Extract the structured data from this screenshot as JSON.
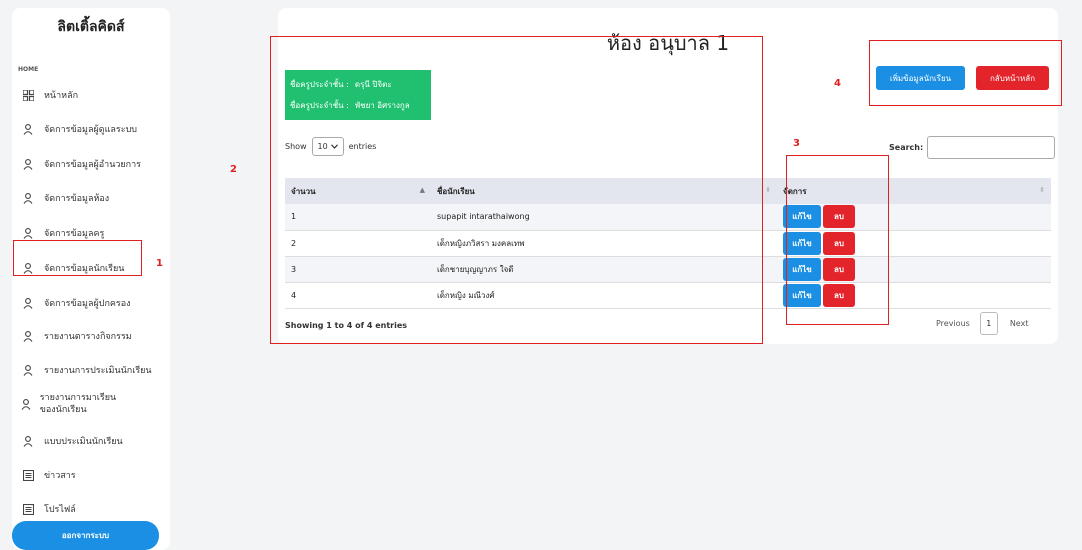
{
  "sidebar": {
    "logo": "ลิตเติ้ลคิดส์",
    "section": "HOME",
    "items": [
      {
        "label": "หน้าหลัก",
        "icon": "grid-icon"
      },
      {
        "label": "จัดการข้อมูลผู้ดูแลระบบ",
        "icon": "user-icon"
      },
      {
        "label": "จัดการข้อมูลผู้อำนวยการ",
        "icon": "user-icon"
      },
      {
        "label": "จัดการข้อมูลห้อง",
        "icon": "user-icon"
      },
      {
        "label": "จัดการข้อมูลครู",
        "icon": "user-icon"
      },
      {
        "label": "จัดการข้อมูลนักเรียน",
        "icon": "user-icon"
      },
      {
        "label": "จัดการข้อมูลผู้ปกครอง",
        "icon": "user-icon"
      },
      {
        "label": "รายงานตารางกิจกรรม",
        "icon": "user-icon"
      },
      {
        "label": "รายงานการประเมินนักเรียน",
        "icon": "user-icon"
      },
      {
        "label": "รายงานการมาเรียนของนักเรียน",
        "icon": "user-icon"
      },
      {
        "label": "แบบประเมินนักเรียน",
        "icon": "user-icon"
      },
      {
        "label": "ข่าวสาร",
        "icon": "list-icon"
      },
      {
        "label": "โปรไฟล์",
        "icon": "list-icon"
      }
    ],
    "logout_label": "ออกจากระบบ"
  },
  "main": {
    "title": "ห้อง อนุบาล 1",
    "teachers": [
      {
        "label": "ชื่อครูประจำชั้น :",
        "name": "ดรุนี ปิจิตะ"
      },
      {
        "label": "ชื่อครูประจำชั้น :",
        "name": "พัชยา อิศรางกูล"
      }
    ],
    "add_button": "เพิ่มข้อมูลนักเรียน",
    "back_button": "กลับหน้าหลัก",
    "show_label": "Show",
    "entries_value": "10",
    "entries_label": "entries",
    "search_label": "Search:",
    "table": {
      "headers": [
        "จำนวน",
        "ชื่อนักเรียน",
        "จัดการ"
      ],
      "rows": [
        {
          "num": "1",
          "name": "supapit intarathaiwong"
        },
        {
          "num": "2",
          "name": "เด็กหญิงภวิสรา มงคลเทพ"
        },
        {
          "num": "3",
          "name": "เด็กชายบุญญาภร ใจดี"
        },
        {
          "num": "4",
          "name": "เด็กหญิง มณีวงศ์"
        }
      ],
      "edit_label": "แก้ไข",
      "delete_label": "ลบ"
    },
    "info_text": "Showing 1 to 4 of 4 entries",
    "pager": {
      "previous": "Previous",
      "page": "1",
      "next": "Next"
    }
  },
  "annotations": [
    "1",
    "2",
    "3",
    "4"
  ],
  "colors": {
    "primary": "#1a8fe3",
    "danger": "#e3242b",
    "success": "#20c070",
    "annotation": "#e02020"
  }
}
